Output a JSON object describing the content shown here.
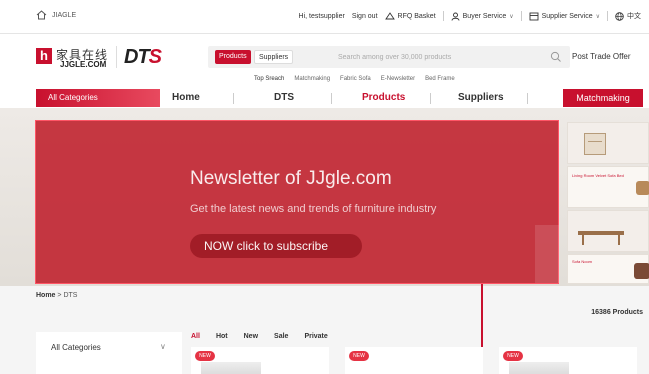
{
  "topbar": {
    "brand": "JIAGLE",
    "greeting": "Hi, testsupplier",
    "sign_out": "Sign out",
    "rfq": "RFQ Basket",
    "buyer_service": "Buyer Service",
    "supplier_service": "Supplier Service",
    "language": "中文"
  },
  "header": {
    "logo_box": "h",
    "logo_cn": "家具在线",
    "logo_en": "JJGLE.COM",
    "dts_logo_a": "DT",
    "dts_logo_b": "S",
    "search": {
      "tab_products": "Products",
      "tab_suppliers": "Suppliers",
      "placeholder": "Search among over 30,000 products"
    },
    "hot_links": [
      "Top Sreach",
      "Matchmaking",
      "Fabric Sofa",
      "E-Newsletter",
      "Bed Frame"
    ],
    "post_offer": "Post Trade Offer"
  },
  "nav": {
    "all_categories": "All Categories",
    "items": [
      "Home",
      "DTS",
      "Products",
      "Suppliers"
    ],
    "matchmaking": "Matchmaking"
  },
  "banner": {
    "title": "Newsletter of JJgle.com",
    "subtitle": "Get the latest news and trends of furniture industry",
    "button": "NOW click to subscribe"
  },
  "side_ads": {
    "ad2_title": "Living Room Velvet Sofa Bed",
    "ad4_title": "Sofa Noom"
  },
  "breadcrumb": {
    "home": "Home",
    "sep": " > ",
    "current": "DTS"
  },
  "products_count": "16386 Products",
  "category_panel": {
    "label": "All Categories"
  },
  "filter_tabs": [
    "All",
    "Hot",
    "New",
    "Sale",
    "Private"
  ],
  "cards": [
    {
      "badge": "NEW"
    },
    {
      "badge": "NEW"
    },
    {
      "badge": "NEW"
    }
  ],
  "colors": {
    "brand_red": "#c8102e",
    "overlay_red": "#c12733"
  }
}
